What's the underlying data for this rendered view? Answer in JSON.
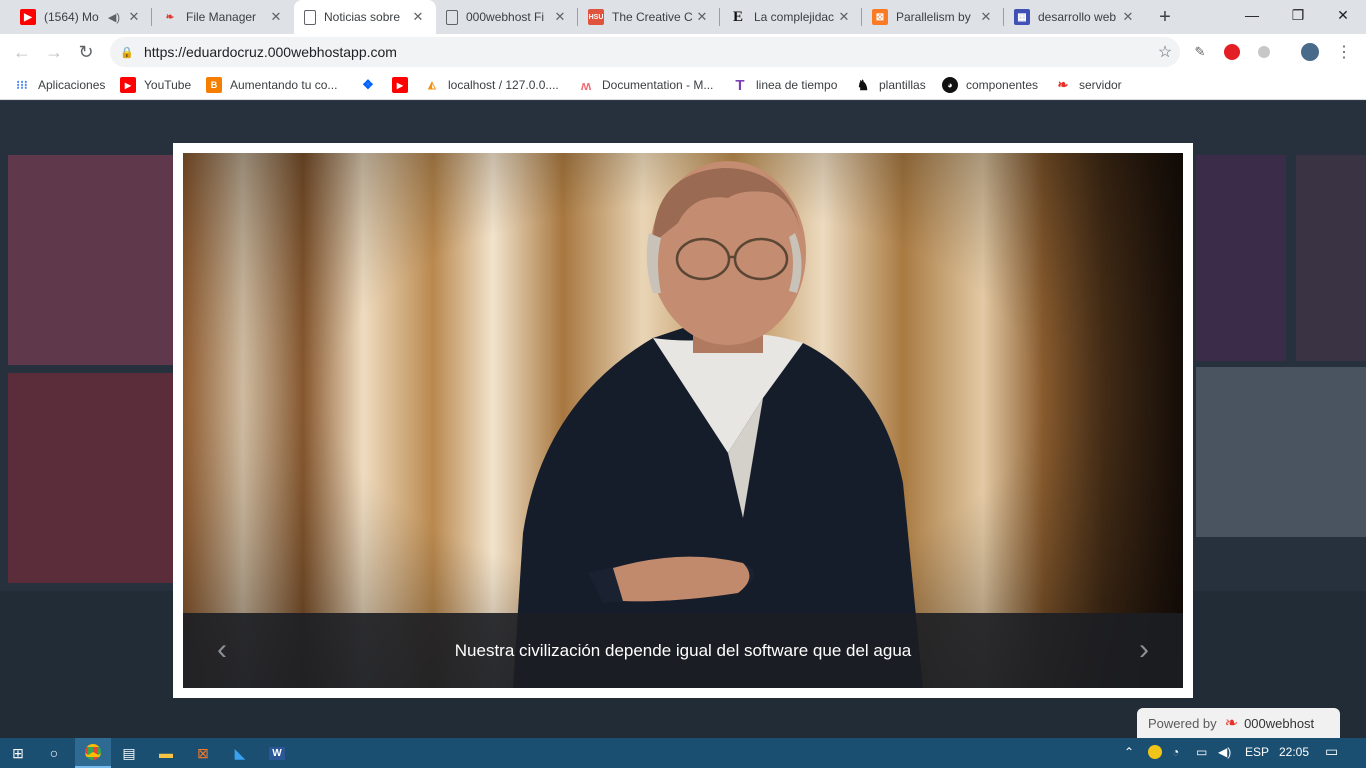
{
  "tabs": [
    {
      "title": "(1564) Mo",
      "icon": "youtube-icon",
      "audio": true
    },
    {
      "title": "File Manager",
      "icon": "000webhost-icon"
    },
    {
      "title": "Noticias sobre",
      "icon": "page-icon",
      "active": true
    },
    {
      "title": "000webhost Fi",
      "icon": "page-icon"
    },
    {
      "title": "The Creative C",
      "icon": "hsu-icon",
      "icon_text": "HSU"
    },
    {
      "title": "La complejidac",
      "icon": "el-pais-icon",
      "icon_text": "E"
    },
    {
      "title": "Parallelism by",
      "icon": "xampp-icon"
    },
    {
      "title": "desarrollo web",
      "icon": "calendar-icon"
    }
  ],
  "window": {
    "minimize": "—",
    "maximize": "❐",
    "close": "✕",
    "new_tab": "+"
  },
  "toolbar": {
    "back": "←",
    "forward": "→",
    "reload": "↻",
    "url": "https://eduardocruz.000webhostapp.com",
    "star": "☆"
  },
  "bookmarks": [
    {
      "label": "Aplicaciones",
      "icon": "apps-grid-icon"
    },
    {
      "label": "YouTube",
      "icon": "youtube-icon"
    },
    {
      "label": "Aumentando tu co...",
      "icon": "blogger-icon"
    },
    {
      "label": "",
      "icon": "dropbox-icon"
    },
    {
      "label": "",
      "icon": "youtube-icon"
    },
    {
      "label": "localhost / 127.0.0....",
      "icon": "phpmyadmin-icon"
    },
    {
      "label": "Documentation - M...",
      "icon": "materialize-icon"
    },
    {
      "label": "linea de tiempo",
      "icon": "tiki-icon"
    },
    {
      "label": "plantillas",
      "icon": "horse-icon"
    },
    {
      "label": "componentes",
      "icon": "github-icon"
    },
    {
      "label": "servidor",
      "icon": "000webhost-icon"
    }
  ],
  "modal": {
    "caption": "Nuestra civilización depende igual del software que del agua",
    "prev": "‹",
    "next": "›"
  },
  "powered": {
    "prefix": "Powered by",
    "brand": "000webhost"
  },
  "taskbar": {
    "lang": "ESP",
    "time": "22:05"
  },
  "colors": {
    "accent": "#1a73e8",
    "modal_caption_bg": "#1c1e24",
    "taskbar": "#1b4f72"
  }
}
